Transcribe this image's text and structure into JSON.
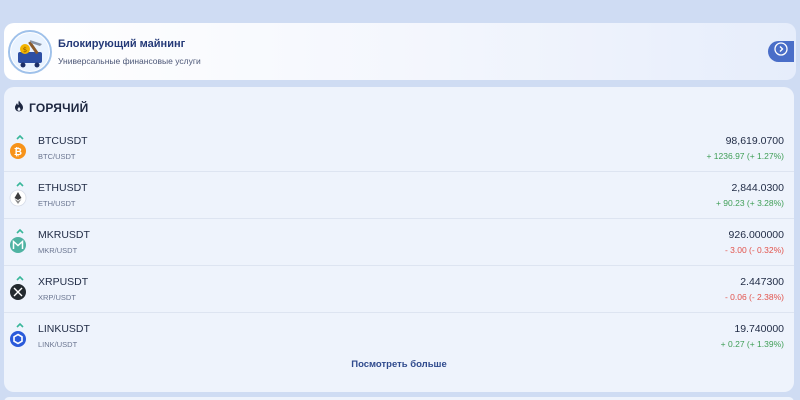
{
  "banner": {
    "title": "Блокирующий майнинг",
    "subtitle": "Универсальные финансовые услуги",
    "logo_icon": "mining-cart-icon",
    "arrow_icon": "chevron-right-icon"
  },
  "hot": {
    "title": "ГОРЯЧИЙ",
    "icon": "flame-icon",
    "rows": [
      {
        "symbol": "BTCUSDT",
        "pair": "BTC/USDT",
        "price": "98,619.0700",
        "change": "+ 1236.97 (+ 1.27%)",
        "direction": "up",
        "icon": "bitcoin-icon",
        "color": "#f7931a"
      },
      {
        "symbol": "ETHUSDT",
        "pair": "ETH/USDT",
        "price": "2,844.0300",
        "change": "+ 90.23 (+ 3.28%)",
        "direction": "up",
        "icon": "ethereum-icon",
        "color": "#ffffff"
      },
      {
        "symbol": "MKRUSDT",
        "pair": "MKR/USDT",
        "price": "926.000000",
        "change": "- 3.00 (- 0.32%)",
        "direction": "down",
        "icon": "maker-icon",
        "color": "#4fb3a2"
      },
      {
        "symbol": "XRPUSDT",
        "pair": "XRP/USDT",
        "price": "2.447300",
        "change": "- 0.06 (- 2.38%)",
        "direction": "down",
        "icon": "xrp-icon",
        "color": "#23292f"
      },
      {
        "symbol": "LINKUSDT",
        "pair": "LINK/USDT",
        "price": "19.740000",
        "change": "+ 0.27 (+ 1.39%)",
        "direction": "up",
        "icon": "chainlink-icon",
        "color": "#2a5ada"
      }
    ],
    "more_label": "Посмотреть больше"
  },
  "colors": {
    "positive": "#3f9e56",
    "negative": "#e2534c",
    "accent": "#4a6ec8"
  }
}
